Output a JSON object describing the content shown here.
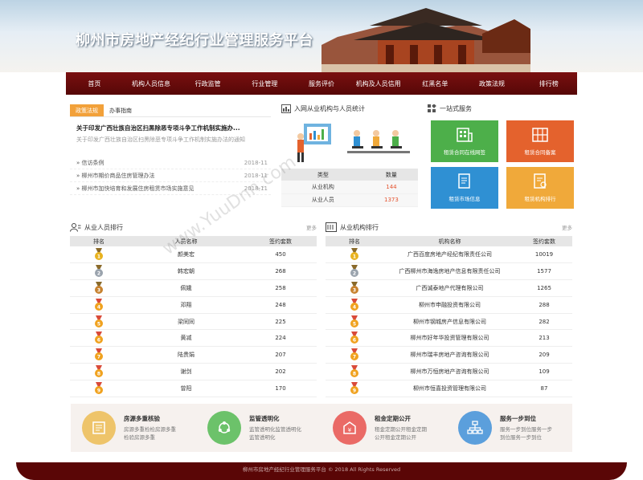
{
  "site": {
    "title": "柳州市房地产经纪行业管理服务平台"
  },
  "nav": [
    "首页",
    "机构人员信息",
    "行政监管",
    "行业管理",
    "服务评价",
    "机构及人员信用",
    "红黑名单",
    "政策法规",
    "排行榜"
  ],
  "policy": {
    "tabs": [
      "政策法规",
      "办事指南"
    ],
    "headline": "关于印发广西壮族自治区扫黑除恶专项斗争工作机制实施办...",
    "summary": "关于印发广西壮族自治区扫黑除恶专项斗争工作机制实施办法的通知",
    "items": [
      {
        "title": "信访条例",
        "date": "2018-11"
      },
      {
        "title": "柳州市期价商品住房管理办法",
        "date": "2018-11"
      },
      {
        "title": "柳州市加快培育和发展住房租赁市场实施意见",
        "date": "2018-11"
      }
    ]
  },
  "stats": {
    "title": "入网从业机构与人员统计",
    "head": [
      "类型",
      "数量"
    ],
    "rows": [
      {
        "type": "从业机构",
        "count": "144"
      },
      {
        "type": "从业人员",
        "count": "1373"
      }
    ]
  },
  "oneStop": {
    "title": "一站式服务",
    "tiles": [
      {
        "label": "租赁合同在线网签",
        "color": "#4daf4a",
        "icon": "building-icon"
      },
      {
        "label": "租赁合同备案",
        "color": "#e4622d",
        "icon": "archive-icon"
      },
      {
        "label": "租赁市场信息",
        "color": "#2f90d3",
        "icon": "document-icon"
      },
      {
        "label": "租赁机构排行",
        "color": "#f0a93a",
        "icon": "list-icon"
      }
    ]
  },
  "personRank": {
    "title": "从业人员排行",
    "more": "更多",
    "head": [
      "排名",
      "人员名称",
      "签约套数"
    ],
    "rows": [
      {
        "rank": "1",
        "name": "颜美宏",
        "count": "450"
      },
      {
        "rank": "2",
        "name": "韩宏朝",
        "count": "268"
      },
      {
        "rank": "3",
        "name": "佩娥",
        "count": "258"
      },
      {
        "rank": "4",
        "name": "邓翔",
        "count": "248"
      },
      {
        "rank": "5",
        "name": "梁同同",
        "count": "225"
      },
      {
        "rank": "6",
        "name": "黄减",
        "count": "224"
      },
      {
        "rank": "7",
        "name": "陆贵娟",
        "count": "207"
      },
      {
        "rank": "8",
        "name": "谢剑",
        "count": "202"
      },
      {
        "rank": "9",
        "name": "曾阳",
        "count": "170"
      }
    ]
  },
  "orgRank": {
    "title": "从业机构排行",
    "more": "更多",
    "head": [
      "排名",
      "机构名称",
      "签约套数"
    ],
    "rows": [
      {
        "rank": "1",
        "name": "广西百度房地产经纪有限责任公司",
        "count": "10019"
      },
      {
        "rank": "2",
        "name": "广西柳州市海逸房地产信息有限责任公司",
        "count": "1577"
      },
      {
        "rank": "3",
        "name": "广西诚泰地产代理有限公司",
        "count": "1265"
      },
      {
        "rank": "4",
        "name": "柳州市申融投资有限公司",
        "count": "288"
      },
      {
        "rank": "5",
        "name": "柳州市钢城房产信息有限公司",
        "count": "282"
      },
      {
        "rank": "6",
        "name": "柳州市好年华投资管理有限公司",
        "count": "213"
      },
      {
        "rank": "7",
        "name": "柳州市瑞丰房地产咨询有限公司",
        "count": "209"
      },
      {
        "rank": "8",
        "name": "柳州市万恒房地产咨询有限公司",
        "count": "109"
      },
      {
        "rank": "9",
        "name": "柳州市恒喜投资管理有限公司",
        "count": "87"
      }
    ]
  },
  "services": [
    {
      "title": "房源多重核验",
      "desc": "房源多重检检房源多重检验房源多重",
      "color": "#eec46a",
      "icon": "ledger-icon"
    },
    {
      "title": "监管透明化",
      "desc": "监管透明化监管透明化监管透明化",
      "color": "#6cc26a",
      "icon": "cycle-icon"
    },
    {
      "title": "租金定期公开",
      "desc": "租金定期公开租金定期公开租金定期公开",
      "color": "#ea6a66",
      "icon": "money-icon"
    },
    {
      "title": "服务一步到位",
      "desc": "服务一步到位服务一步到位服务一步到位",
      "color": "#5b9fdc",
      "icon": "org-icon"
    }
  ],
  "footer": {
    "text": "柳州市房地产经纪行业管理服务平台 © 2018 All Rights Reserved"
  },
  "watermark": "www.YuuDnn.com"
}
